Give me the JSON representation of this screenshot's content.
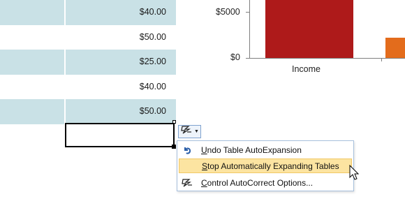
{
  "table": {
    "rows": [
      {
        "amount": "$40.00",
        "band": true
      },
      {
        "amount": "$50.00",
        "band": false
      },
      {
        "amount": "$25.00",
        "band": true
      },
      {
        "amount": "$40.00",
        "band": false
      },
      {
        "amount": "$50.00",
        "band": true
      }
    ]
  },
  "chart": {
    "tick_5000": "$5000",
    "tick_0": "$0",
    "category": "Income",
    "colors": {
      "income": "#ae1a1a",
      "expense": "#e36c1c"
    }
  },
  "menu": {
    "items": [
      {
        "access_key": "U",
        "rest": "ndo Table AutoExpansion",
        "icon": "undo-icon"
      },
      {
        "access_key": "S",
        "rest": "top Automatically Expanding Tables",
        "icon": "none"
      },
      {
        "access_key": "C",
        "rest": "ontrol AutoCorrect Options...",
        "icon": "autocorrect-lightning-icon"
      }
    ]
  }
}
